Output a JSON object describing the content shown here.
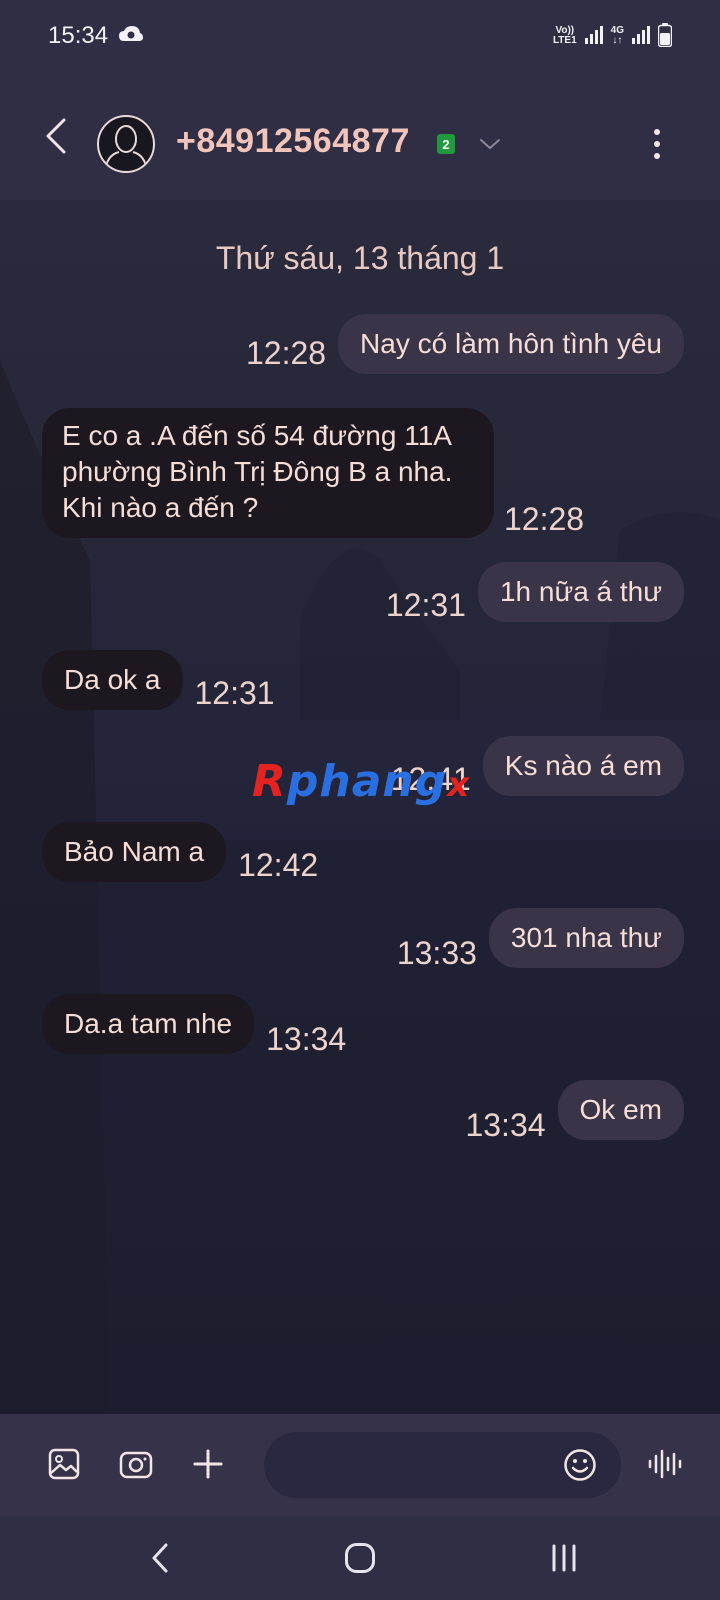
{
  "status_bar": {
    "time": "15:34",
    "volte_label": "Vo))",
    "lte_label": "LTE1",
    "net_label": "4G",
    "icons": [
      "cloud-sync-icon",
      "signal-icon",
      "signal-icon",
      "battery-icon"
    ]
  },
  "header": {
    "contact": "+84912564877",
    "sim_badge": "2"
  },
  "conversation": {
    "date": "Thứ sáu, 13 tháng 1",
    "messages": [
      {
        "dir": "out",
        "text": "Nay có làm hôn tình yêu",
        "time": "12:28"
      },
      {
        "dir": "in",
        "text": "E co a .A đến số 54 đường 11A phường Bình Trị Đông B a nha. Khi nào a đến ?",
        "time": "12:28"
      },
      {
        "dir": "out",
        "text": "1h nữa á thư",
        "time": "12:31"
      },
      {
        "dir": "in",
        "text": "Da ok a",
        "time": "12:31"
      },
      {
        "dir": "out",
        "text": "Ks nào á em",
        "time": "12:41"
      },
      {
        "dir": "in",
        "text": "Bảo Nam a",
        "time": "12:42"
      },
      {
        "dir": "out",
        "text": "301 nha thư",
        "time": "13:33"
      },
      {
        "dir": "in",
        "text": "Da.a tam nhe",
        "time": "13:34"
      },
      {
        "dir": "out",
        "text": "Ok em",
        "time": "13:34"
      }
    ]
  },
  "watermark": {
    "first": "R",
    "middle": "phang",
    "last": "x"
  },
  "compose": {
    "icons": [
      "gallery-icon",
      "camera-icon",
      "plus-icon",
      "emoji-icon",
      "voice-icon"
    ]
  },
  "colors": {
    "accent_name": "#f3c5ba",
    "bubble_out": "#3a3448",
    "bubble_in": "#1d1820",
    "sim_badge": "#1f9a3c"
  }
}
